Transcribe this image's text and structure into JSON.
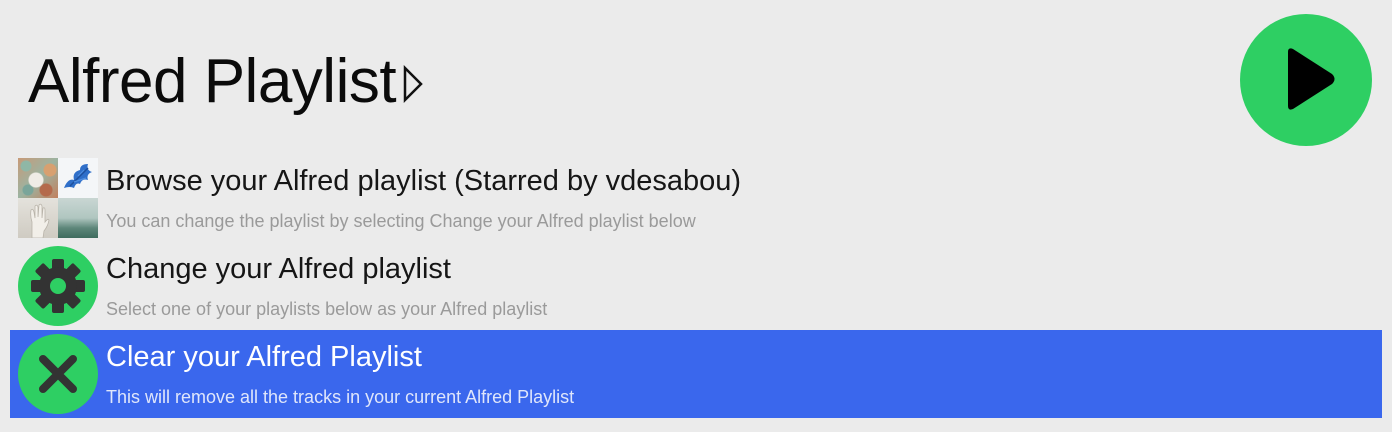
{
  "search": {
    "query": "Alfred Playlist",
    "caret_icon": "triangle-right-icon"
  },
  "app_icon": {
    "name": "play-icon",
    "color": "#2ecf63"
  },
  "results": [
    {
      "title": "Browse your Alfred playlist (Starred by vdesabou)",
      "subtitle": "You can change the playlist by selecting Change your Alfred playlist below",
      "icon": "playlist-artwork-icon"
    },
    {
      "title": "Change your Alfred playlist",
      "subtitle": "Select one of your playlists below as your Alfred playlist",
      "icon": "gear-icon"
    },
    {
      "title": "Clear your Alfred Playlist",
      "subtitle": "This will remove all the tracks in your current Alfred Playlist",
      "icon": "close-icon",
      "selected": true
    }
  ],
  "colors": {
    "background": "#ebebeb",
    "selection": "#3a67ed",
    "accent_green": "#2ecf63"
  }
}
